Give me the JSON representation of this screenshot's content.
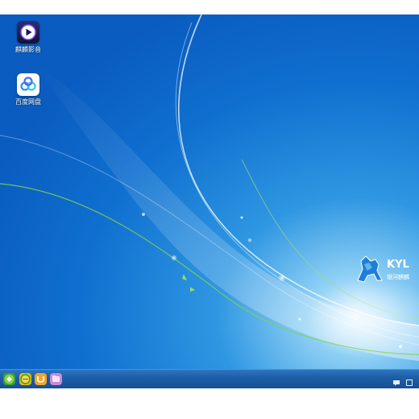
{
  "desktop": {
    "icons": [
      {
        "label": "麒麟影音",
        "icon": "video-player-icon"
      },
      {
        "label": "百度网盘",
        "icon": "cloud-drive-icon"
      }
    ],
    "brand": {
      "text": "KYL",
      "subtext": "银河麒麟"
    }
  },
  "taskbar": {
    "apps": [
      {
        "icon": "start-menu-icon"
      },
      {
        "icon": "browser-icon"
      },
      {
        "icon": "software-store-icon"
      },
      {
        "icon": "file-manager-icon"
      }
    ],
    "tray": [
      {
        "icon": "chat-icon"
      },
      {
        "icon": "show-desktop-icon"
      }
    ]
  },
  "colors": {
    "wallpaper_top": "#0b62c6",
    "wallpaper_bottom": "#1a86dd",
    "taskbar": "#1d5fa8",
    "accent_green": "#7fd34a"
  }
}
